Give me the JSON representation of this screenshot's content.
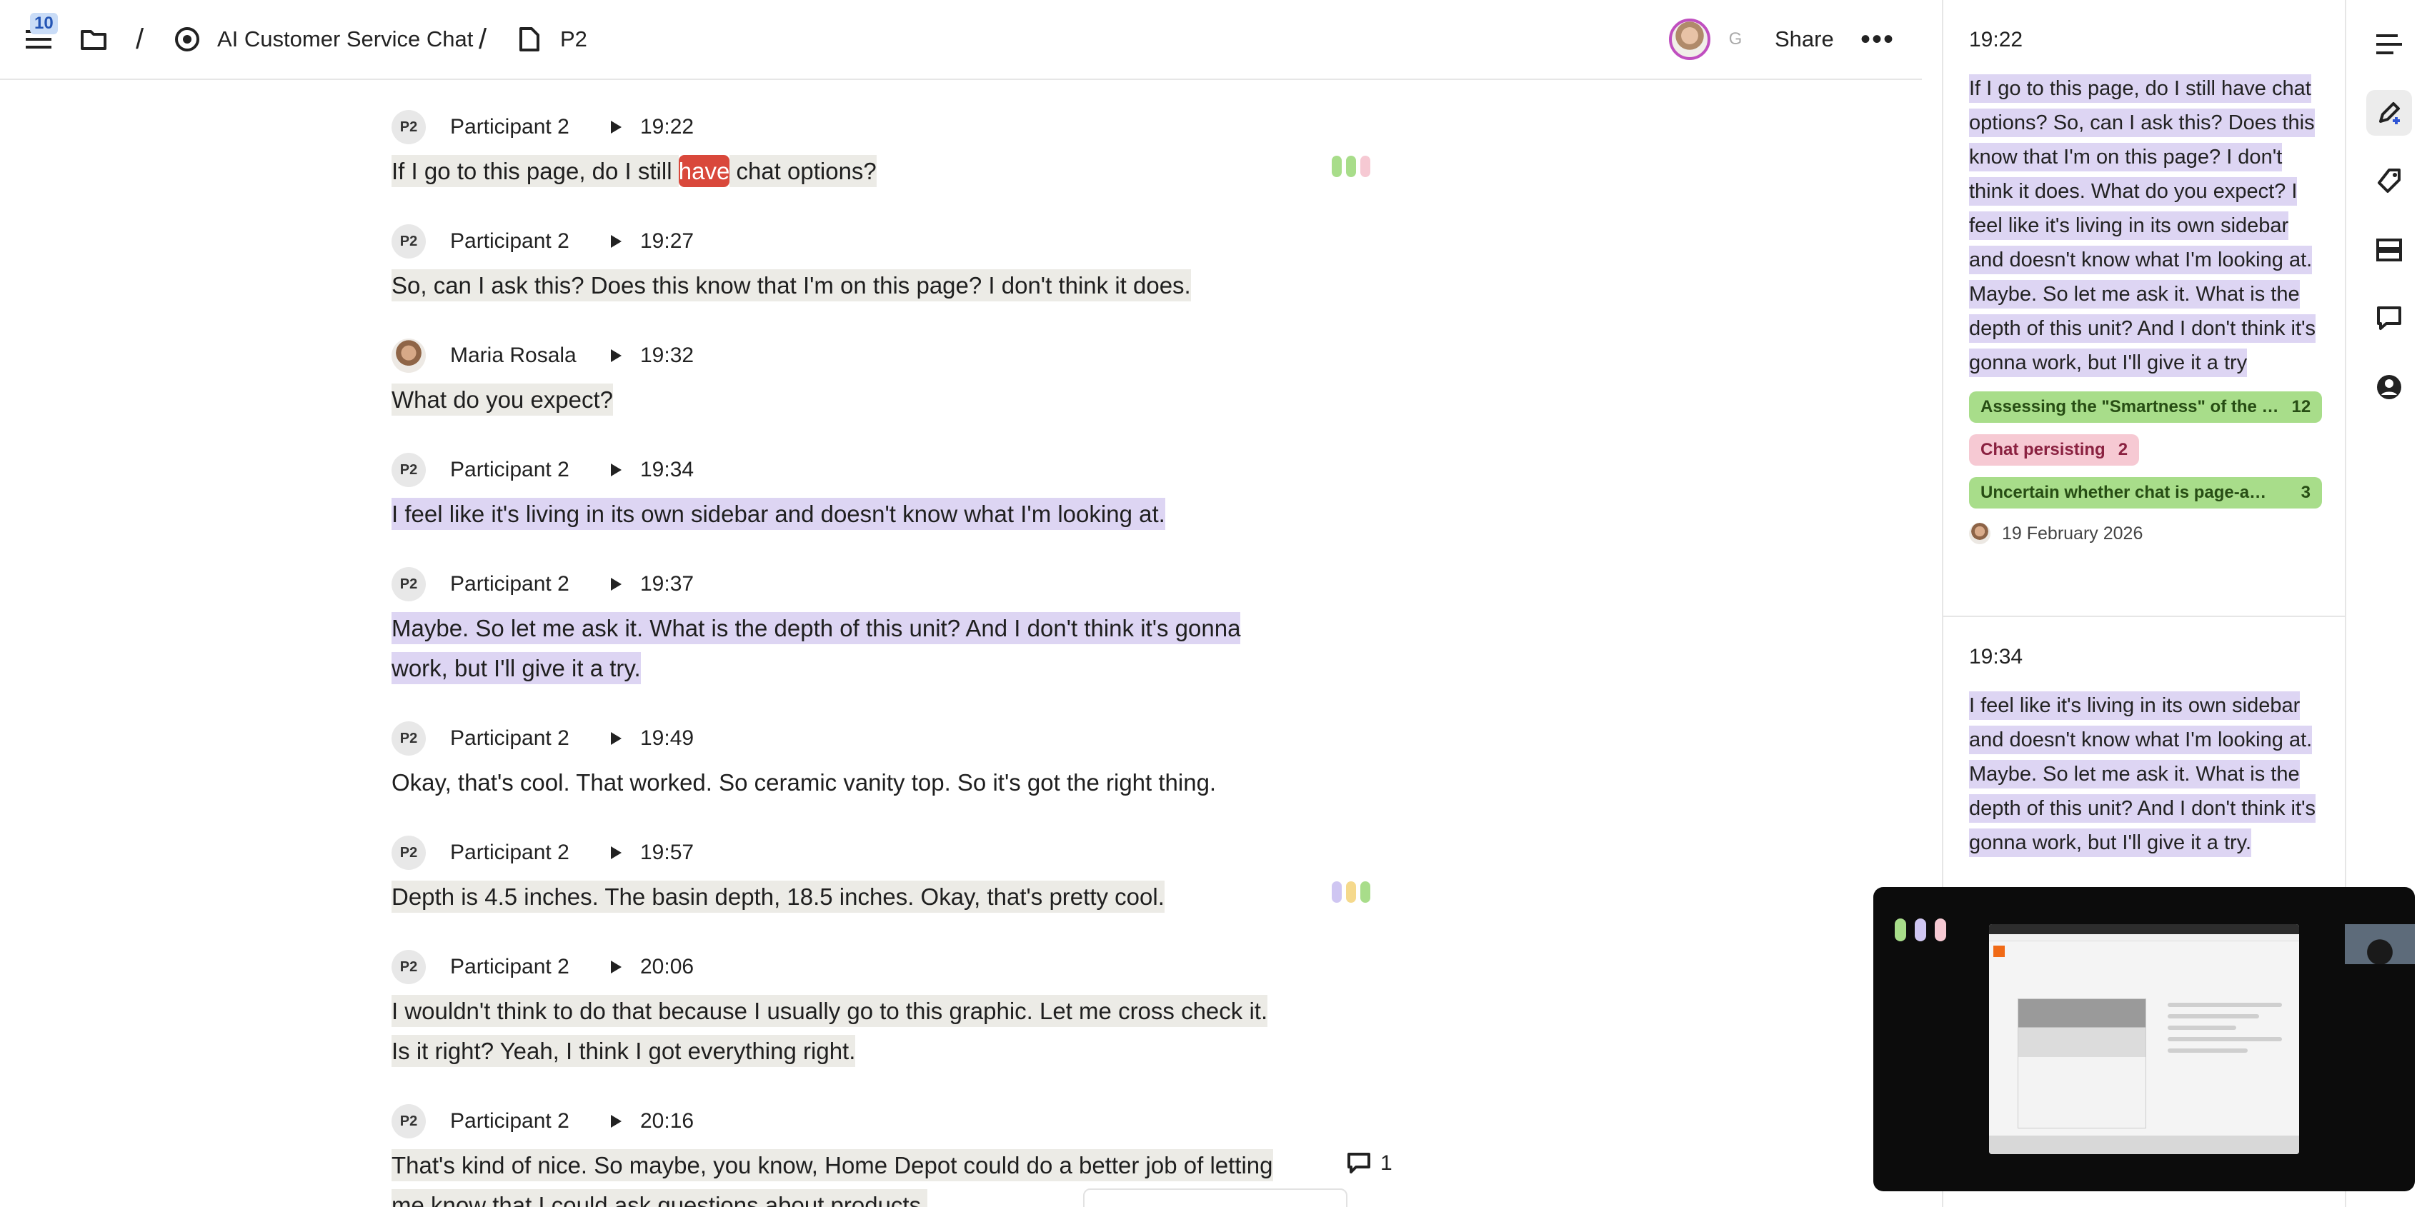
{
  "topbar": {
    "menu_badge": "10",
    "separator": "/",
    "project_title": "AI Customer Service Chat",
    "doc_title": "P2",
    "guest_initial": "G",
    "share_label": "Share",
    "more_label": "•••"
  },
  "transcript": [
    {
      "avatar": "P2",
      "speaker": "Participant 2",
      "time": "19:22",
      "parts": [
        {
          "t": "If I go to this page, do I still ",
          "hl": "beige"
        },
        {
          "t": "have",
          "hl": "red"
        },
        {
          "t": " chat options?",
          "hl": "beige"
        }
      ]
    },
    {
      "avatar": "P2",
      "speaker": "Participant 2",
      "time": "19:27",
      "parts": [
        {
          "t": "So, can I ask this? Does this know that I'm on this page? I don't think it does.",
          "hl": "beige"
        }
      ]
    },
    {
      "avatar": "",
      "speaker": "Maria Rosala",
      "time": "19:32",
      "parts": [
        {
          "t": "What do you expect?",
          "hl": "beige"
        }
      ]
    },
    {
      "avatar": "P2",
      "speaker": "Participant 2",
      "time": "19:34",
      "parts": [
        {
          "t": "I feel like it's living in its own sidebar and doesn't know what I'm looking at.",
          "hl": "purple"
        }
      ]
    },
    {
      "avatar": "P2",
      "speaker": "Participant 2",
      "time": "19:37",
      "parts": [
        {
          "t": "Maybe. So let me ask it. What is the depth of this unit? And I don't think it's gonna work, but I'll give it a try.",
          "hl": "purple"
        }
      ]
    },
    {
      "avatar": "P2",
      "speaker": "Participant 2",
      "time": "19:49",
      "parts": [
        {
          "t": "Okay, that's cool. That worked. So ceramic vanity top. So it's got the right thing.",
          "hl": "none"
        }
      ]
    },
    {
      "avatar": "P2",
      "speaker": "Participant 2",
      "time": "19:57",
      "parts": [
        {
          "t": "Depth is 4.5 inches. The basin depth, 18.5 inches. Okay, that's pretty cool.",
          "hl": "beige"
        }
      ]
    },
    {
      "avatar": "P2",
      "speaker": "Participant 2",
      "time": "20:06",
      "parts": [
        {
          "t": "I wouldn't think to do that because I usually go to this graphic. Let me cross check it. Is it right? Yeah, I think I got everything right.",
          "hl": "beige"
        }
      ]
    },
    {
      "avatar": "P2",
      "speaker": "Participant 2",
      "time": "20:16",
      "parts": [
        {
          "t": "That's kind of nice. So maybe, you know, Home Depot could do a better job of letting me know that I could ask questions about products.",
          "hl": "beige"
        }
      ]
    }
  ],
  "tag_colors": {
    "green": "#a8dd8a",
    "yellow": "#f5d98c",
    "pink": "#f6c9d3",
    "purple": "#cfc6f2"
  },
  "comment_count": "1",
  "highlights": [
    {
      "time": "19:22",
      "quote": "If I go to this page, do I still have chat options? So, can I ask this? Does this know that I'm on this page? I don't think it does. What do you expect? I feel like it's living in its own sidebar and doesn't know what I'm looking at. Maybe. So let me ask it. What is the depth of this unit? And I don't think it's gonna work, but I'll give it a try",
      "tags": [
        {
          "label": "Assessing the \"Smartness\" of the …",
          "count": "12",
          "color": "green"
        },
        {
          "label": "Chat persisting",
          "count": "2",
          "color": "pink"
        },
        {
          "label": "Uncertain whether chat is page-a…",
          "count": "3",
          "color": "green"
        }
      ],
      "date": "19 February 2026"
    },
    {
      "time": "19:34",
      "quote": "I feel like it's living in its own sidebar and doesn't know what I'm looking at. Maybe. So let me ask it. What is the depth of this unit? And I don't think it's gonna work, but I'll give it a try."
    }
  ],
  "rail": [
    "list-icon",
    "highlight-pen-icon",
    "tag-icon",
    "layers-icon",
    "comment-icon",
    "user-circle-icon"
  ]
}
